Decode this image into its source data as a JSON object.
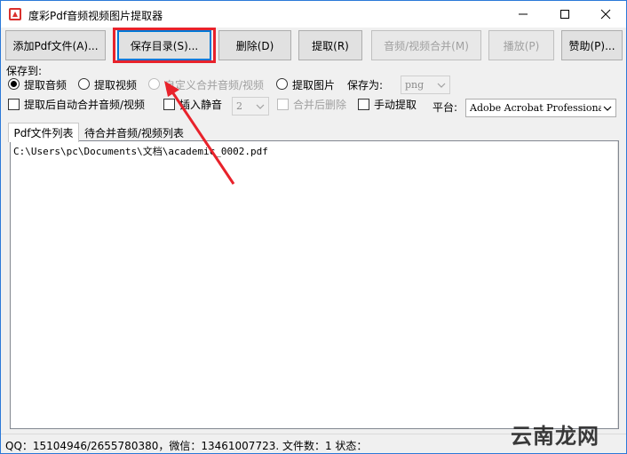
{
  "window": {
    "title": "度彩Pdf音频视频图片提取器"
  },
  "toolbar": {
    "add_pdf": "添加Pdf文件(A)...",
    "save_dir": "保存目录(S)...",
    "delete": "删除(D)",
    "extract": "提取(R)",
    "merge": "音频/视频合并(M)",
    "play": "播放(P)",
    "donate": "赞助(P)..."
  },
  "options": {
    "save_to_label": "保存到:",
    "extract_audio": "提取音频",
    "extract_video": "提取视频",
    "custom_merge": "自定义合并音频/视频",
    "extract_image": "提取图片",
    "save_as_label": "保存为:",
    "save_as_value": "png",
    "auto_merge": "提取后自动合并音频/视频",
    "insert_silence": "插入静音",
    "silence_value": "2",
    "delete_after_merge": "合并后删除",
    "manual_extract": "手动提取",
    "platform_label": "平台:",
    "platform_value": "Adobe Acrobat Professiona"
  },
  "tabs": {
    "pdf_list": "Pdf文件列表",
    "pending_list": "待合并音频/视频列表"
  },
  "files": [
    "C:\\Users\\pc\\Documents\\文档\\academic_0002.pdf"
  ],
  "status": {
    "text": "QQ：15104946/2655780380，微信：13461007723. 文件数：1  状态："
  },
  "watermark": {
    "text": "云南龙网"
  },
  "colors": {
    "annotation": "#e8222b",
    "accent": "#0078d7"
  }
}
